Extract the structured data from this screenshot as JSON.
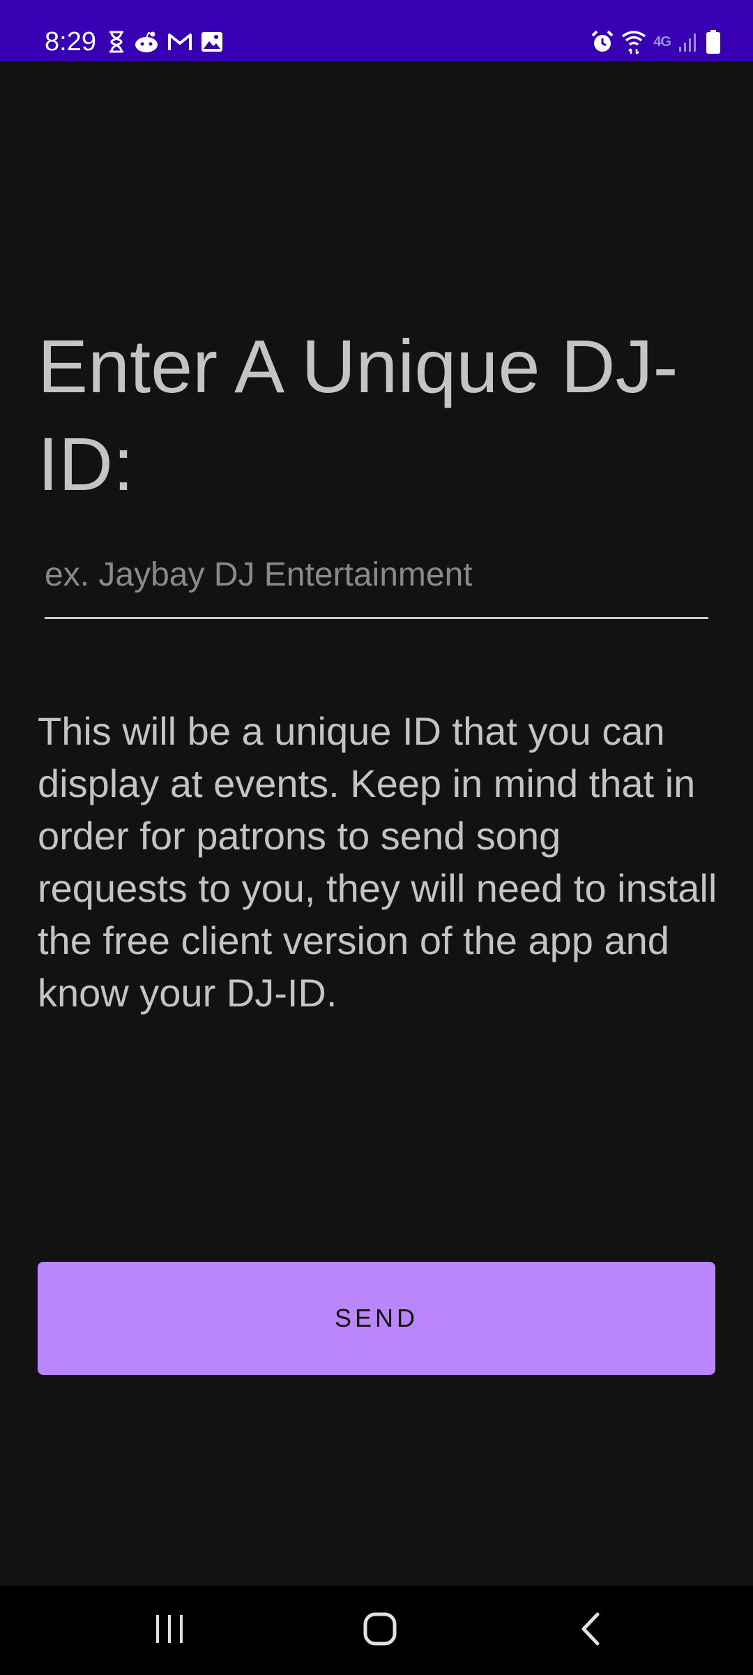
{
  "status_bar": {
    "time": "8:29",
    "left_icons": [
      "hourglass-icon",
      "reddit-icon",
      "gmail-icon",
      "image-icon"
    ],
    "network_label": "4G",
    "right_icons": [
      "alarm-icon",
      "wifi-icon",
      "signal-icon",
      "battery-icon"
    ],
    "background_color": "#3700b3"
  },
  "main": {
    "title": "Enter A Unique DJ-ID:",
    "input": {
      "value": "",
      "placeholder": "ex. Jaybay DJ Entertainment"
    },
    "description": "This will be a unique ID that you can display at events. Keep in mind that in order for patrons to send song requests to you, they will need to install the free client version of the app and know your DJ-ID.",
    "send_button_label": "SEND",
    "accent_color": "#bb86fc"
  },
  "nav_bar": {
    "buttons": [
      "recents-icon",
      "home-icon",
      "back-icon"
    ]
  }
}
